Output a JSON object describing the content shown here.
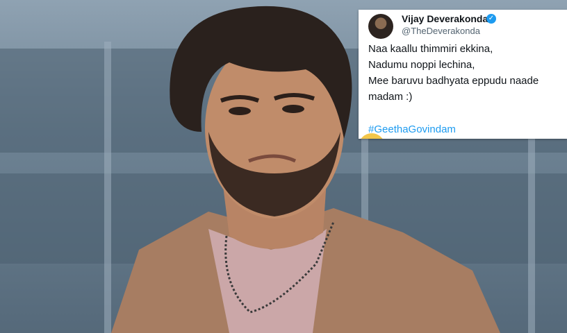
{
  "tweet": {
    "display_name": "Vijay Deverakonda",
    "handle": "@TheDeverakonda",
    "verified_icon": "verified-badge-icon",
    "lines": [
      "Naa kaallu thimmiri ekkina,",
      "Nadumu noppi lechina,",
      "Mee baruvu badhyata eppudu naade",
      "madam :)"
    ],
    "hashtag": "#GeethaGovindam"
  },
  "colors": {
    "link": "#1d9bf0",
    "text": "#0f1419",
    "muted": "#536471",
    "shirt": "#a77d62",
    "tshirt": "#cba7a8"
  }
}
